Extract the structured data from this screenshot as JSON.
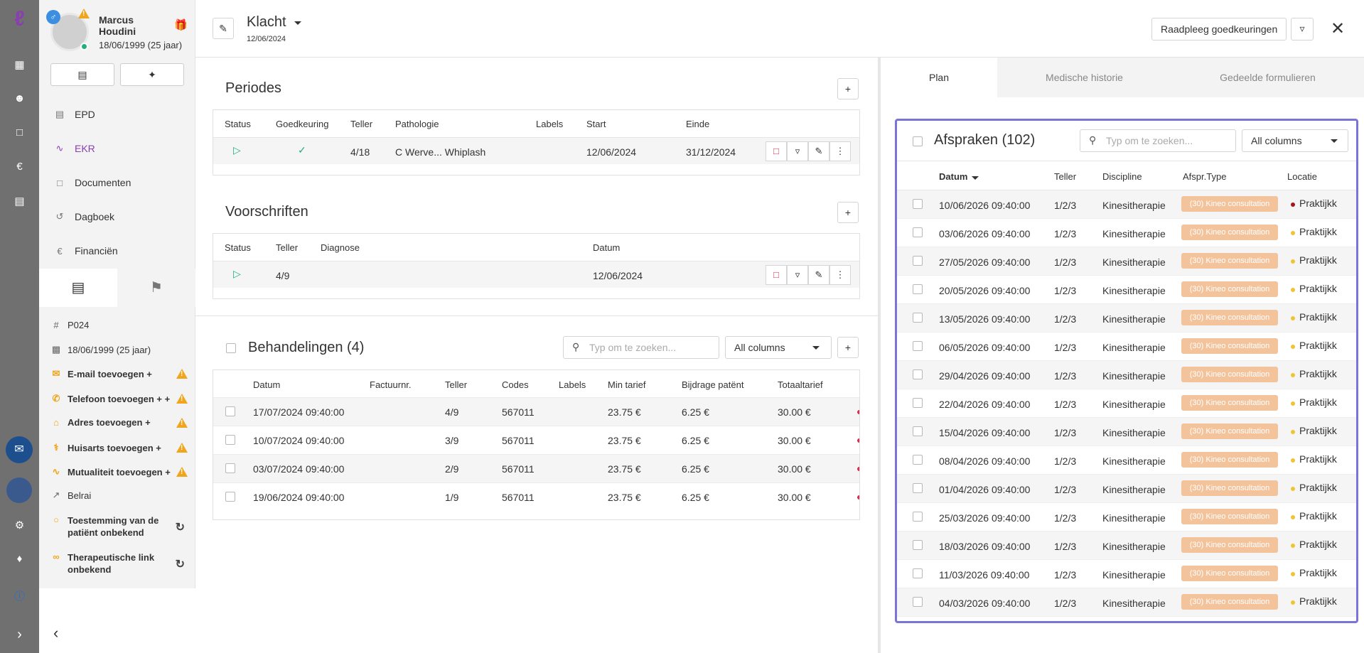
{
  "patient": {
    "name": "Marcus Houdini",
    "dob": "18/06/1999 (25 jaar)"
  },
  "nav": [
    {
      "label": "EPD",
      "icon": "document-icon"
    },
    {
      "label": "EKR",
      "icon": "activity-icon"
    },
    {
      "label": "Documenten",
      "icon": "file-icon"
    },
    {
      "label": "Dagboek",
      "icon": "history-icon"
    },
    {
      "label": "Financiën",
      "icon": "euro-icon"
    }
  ],
  "info": {
    "code": "P024",
    "dob": "18/06/1999 (25 jaar)",
    "email": "E-mail toevoegen +",
    "phone": "Telefoon toevoegen + +",
    "address": "Adres toevoegen +",
    "gp": "Huisarts toevoegen +",
    "mutual": "Mutualiteit toevoegen +",
    "belrai": "Belrai",
    "consent": "Toestemming van de patiënt onbekend",
    "therapeutic": "Therapeutische link onbekend"
  },
  "header": {
    "title": "Klacht",
    "date": "12/06/2024",
    "consult_button": "Raadpleeg goedkeuringen"
  },
  "periodes": {
    "title": "Periodes",
    "columns": [
      "Status",
      "Goedkeuring",
      "Teller",
      "Pathologie",
      "Labels",
      "Start",
      "Einde"
    ],
    "row": {
      "teller": "4/18",
      "pathologie": "C Werve... Whiplash",
      "start": "12/06/2024",
      "einde": "31/12/2024"
    }
  },
  "voorschriften": {
    "title": "Voorschriften",
    "columns": [
      "Status",
      "Teller",
      "Diagnose",
      "Datum"
    ],
    "row": {
      "teller": "4/9",
      "datum": "12/06/2024"
    }
  },
  "behandelingen": {
    "title": "Behandelingen (4)",
    "search_placeholder": "Typ om te zoeken...",
    "filter": "All columns",
    "columns": [
      "Datum",
      "Factuurnr.",
      "Teller",
      "Codes",
      "Labels",
      "Min tarief",
      "Bijdrage patënt",
      "Totaaltarief"
    ],
    "rows": [
      {
        "datum": "17/07/2024 09:40:00",
        "teller": "4/9",
        "codes": "567011",
        "min": "23.75 €",
        "bijdrage": "6.25 €",
        "totaal": "30.00 €"
      },
      {
        "datum": "10/07/2024 09:40:00",
        "teller": "3/9",
        "codes": "567011",
        "min": "23.75 €",
        "bijdrage": "6.25 €",
        "totaal": "30.00 €"
      },
      {
        "datum": "03/07/2024 09:40:00",
        "teller": "2/9",
        "codes": "567011",
        "min": "23.75 €",
        "bijdrage": "6.25 €",
        "totaal": "30.00 €"
      },
      {
        "datum": "19/06/2024 09:40:00",
        "teller": "1/9",
        "codes": "567011",
        "min": "23.75 €",
        "bijdrage": "6.25 €",
        "totaal": "30.00 €"
      }
    ]
  },
  "tabs": [
    "Plan",
    "Medische historie",
    "Gedeelde formulieren"
  ],
  "afspraken": {
    "title": "Afspraken (102)",
    "search_placeholder": "Typ om te zoeken...",
    "filter": "All columns",
    "columns": [
      "Datum",
      "Teller",
      "Discipline",
      "Afspr.Type",
      "Locatie"
    ],
    "rows": [
      {
        "datum": "10/06/2026 09:40:00",
        "teller": "1/2/3",
        "discipline": "Kinesitherapie",
        "type": "(30) Kineo consultation",
        "locatie": "Praktijkk",
        "dot": "#a01818"
      },
      {
        "datum": "03/06/2026 09:40:00",
        "teller": "1/2/3",
        "discipline": "Kinesitherapie",
        "type": "(30) Kineo consultation",
        "locatie": "Praktijkk",
        "dot": "#f2c232"
      },
      {
        "datum": "27/05/2026 09:40:00",
        "teller": "1/2/3",
        "discipline": "Kinesitherapie",
        "type": "(30) Kineo consultation",
        "locatie": "Praktijkk",
        "dot": "#f2c232"
      },
      {
        "datum": "20/05/2026 09:40:00",
        "teller": "1/2/3",
        "discipline": "Kinesitherapie",
        "type": "(30) Kineo consultation",
        "locatie": "Praktijkk",
        "dot": "#f2c232"
      },
      {
        "datum": "13/05/2026 09:40:00",
        "teller": "1/2/3",
        "discipline": "Kinesitherapie",
        "type": "(30) Kineo consultation",
        "locatie": "Praktijkk",
        "dot": "#f2c232"
      },
      {
        "datum": "06/05/2026 09:40:00",
        "teller": "1/2/3",
        "discipline": "Kinesitherapie",
        "type": "(30) Kineo consultation",
        "locatie": "Praktijkk",
        "dot": "#f2c232"
      },
      {
        "datum": "29/04/2026 09:40:00",
        "teller": "1/2/3",
        "discipline": "Kinesitherapie",
        "type": "(30) Kineo consultation",
        "locatie": "Praktijkk",
        "dot": "#f2c232"
      },
      {
        "datum": "22/04/2026 09:40:00",
        "teller": "1/2/3",
        "discipline": "Kinesitherapie",
        "type": "(30) Kineo consultation",
        "locatie": "Praktijkk",
        "dot": "#f2c232"
      },
      {
        "datum": "15/04/2026 09:40:00",
        "teller": "1/2/3",
        "discipline": "Kinesitherapie",
        "type": "(30) Kineo consultation",
        "locatie": "Praktijkk",
        "dot": "#f2c232"
      },
      {
        "datum": "08/04/2026 09:40:00",
        "teller": "1/2/3",
        "discipline": "Kinesitherapie",
        "type": "(30) Kineo consultation",
        "locatie": "Praktijkk",
        "dot": "#f2c232"
      },
      {
        "datum": "01/04/2026 09:40:00",
        "teller": "1/2/3",
        "discipline": "Kinesitherapie",
        "type": "(30) Kineo consultation",
        "locatie": "Praktijkk",
        "dot": "#f2c232"
      },
      {
        "datum": "25/03/2026 09:40:00",
        "teller": "1/2/3",
        "discipline": "Kinesitherapie",
        "type": "(30) Kineo consultation",
        "locatie": "Praktijkk",
        "dot": "#f2c232"
      },
      {
        "datum": "18/03/2026 09:40:00",
        "teller": "1/2/3",
        "discipline": "Kinesitherapie",
        "type": "(30) Kineo consultation",
        "locatie": "Praktijkk",
        "dot": "#f2c232"
      },
      {
        "datum": "11/03/2026 09:40:00",
        "teller": "1/2/3",
        "discipline": "Kinesitherapie",
        "type": "(30) Kineo consultation",
        "locatie": "Praktijkk",
        "dot": "#f2c232"
      },
      {
        "datum": "04/03/2026 09:40:00",
        "teller": "1/2/3",
        "discipline": "Kinesitherapie",
        "type": "(30) Kineo consultation",
        "locatie": "Praktijkk",
        "dot": "#f2c232"
      }
    ]
  },
  "colors": {
    "accent": "#8a3fb0",
    "highlight_border": "#7a74d8",
    "play": "#22b07a",
    "warning": "#f0a51c",
    "pill": "#f3c49c"
  }
}
